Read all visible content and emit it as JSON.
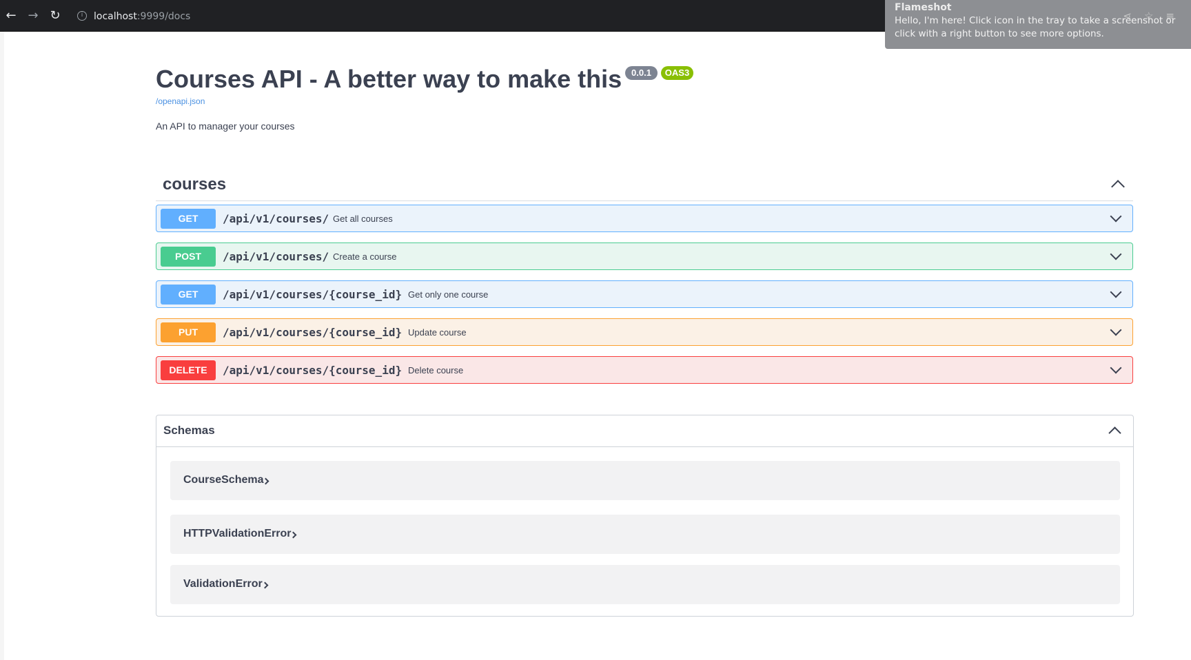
{
  "browser": {
    "url_host": "localhost",
    "url_rest": ":9999/docs",
    "back_icon": "arrow-left-icon",
    "forward_icon": "arrow-right-icon",
    "reload_icon": "reload-icon"
  },
  "notification": {
    "title": "Flameshot",
    "body": "Hello, I'm here! Click icon in the tray to take a screenshot or click with a right button to see more options."
  },
  "info": {
    "title": "Courses API - A better way to make this",
    "version": "0.0.1",
    "oas": "OAS3",
    "openapi_link": "/openapi.json",
    "description": "An API to manager your courses"
  },
  "tag": {
    "name": "courses"
  },
  "operations": [
    {
      "method": "GET",
      "path": "/api/v1/courses/",
      "summary": "Get all courses"
    },
    {
      "method": "POST",
      "path": "/api/v1/courses/",
      "summary": "Create a course"
    },
    {
      "method": "GET",
      "path": "/api/v1/courses/{course_id}",
      "summary": "Get only one course"
    },
    {
      "method": "PUT",
      "path": "/api/v1/courses/{course_id}",
      "summary": "Update course"
    },
    {
      "method": "DELETE",
      "path": "/api/v1/courses/{course_id}",
      "summary": "Delete course"
    }
  ],
  "schemas": {
    "title": "Schemas",
    "models": [
      "CourseSchema",
      "HTTPValidationError",
      "ValidationError"
    ]
  },
  "colors": {
    "get": "#61affe",
    "post": "#49cc90",
    "put": "#fca130",
    "delete": "#f93e3e"
  }
}
